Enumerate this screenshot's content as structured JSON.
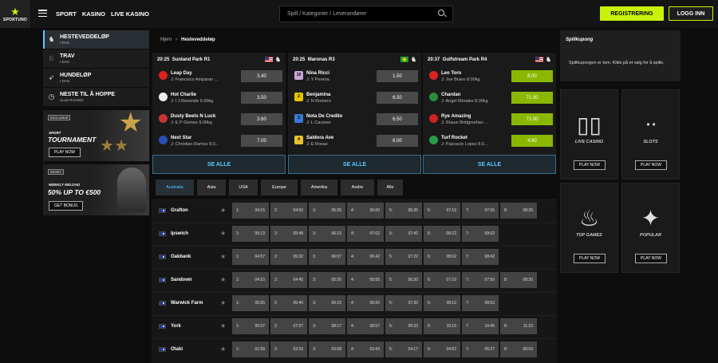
{
  "header": {
    "logo_text": "SPORTUNO",
    "nav": [
      "SPORT",
      "KASINO",
      "LIVE KASINO"
    ],
    "search_placeholder": "Spill / Kategorier / Leverandører",
    "register_label": "REGISTRERING",
    "login_label": "LOGG INN"
  },
  "sidebar": {
    "items": [
      {
        "label": "HESTEVEDDELØP",
        "sub": "I DAG",
        "icon": "horse-icon",
        "active": true
      },
      {
        "label": "TRAV",
        "sub": "I DAG",
        "icon": "trotting-icon"
      },
      {
        "label": "HUNDELØP",
        "sub": "I DAG",
        "icon": "greyhound-icon"
      },
      {
        "label": "NESTE TIL Å HOPPE",
        "sub": "ALLE RACING",
        "icon": "clock-icon"
      }
    ],
    "promo1": {
      "tag": "EXCLUSIVE",
      "line1": "SPORT",
      "title": "TOURNAMENT",
      "button": "PLAY NOW"
    },
    "promo2": {
      "tag": "SPORT",
      "line1": "WEEKLY RELOAD",
      "title": "50% UP TO €500",
      "button": "GET BONUS"
    }
  },
  "breadcrumb": {
    "home": "Hjem",
    "current": "Hesteveddeløp"
  },
  "featured": [
    {
      "time": "20:25",
      "track": "Sunland Park R1",
      "flag": "us",
      "runners": [
        {
          "name": "Leap Day",
          "jockey": "J: Francisco Amparan ...",
          "odds": "3.40",
          "silk": "#d22"
        },
        {
          "name": "Hot Charlie",
          "jockey": "J: I J Resende 9.00kg",
          "odds": "3.50",
          "silk": "#eee"
        },
        {
          "name": "Dusty Beets N Luck",
          "jockey": "J: E P Gomez 9.00kg",
          "odds": "3.60",
          "silk": "#c33"
        },
        {
          "name": "Next Star",
          "jockey": "J: Christian Ramos 9.0...",
          "odds": "7.00",
          "silk": "#2b4fb4"
        }
      ],
      "see_all": "SE ALLE"
    },
    {
      "time": "20:25",
      "track": "Maronas R3",
      "flag": "br",
      "runners": [
        {
          "name": "Nina Ricci",
          "jockey": "J: Y Pereira",
          "odds": "1.50",
          "silk": "#c9a4d8",
          "num": "10"
        },
        {
          "name": "Benjamina",
          "jockey": "J: N Romero",
          "odds": "6.50",
          "silk": "#e2c400",
          "num": "2"
        },
        {
          "name": "Nota De Credito",
          "jockey": "J: L Caceres",
          "odds": "6.50",
          "silk": "#3a7bd5",
          "num": "3"
        },
        {
          "name": "Saldora Ave",
          "jockey": "J: E Rosas",
          "odds": "8.00",
          "silk": "#e8c32a",
          "num": "4"
        }
      ],
      "see_all": "SE ALLE"
    },
    {
      "time": "20:37",
      "track": "Gulfstream Park R4",
      "flag": "us",
      "runners": [
        {
          "name": "Leo Toro",
          "jockey": "J: Joe Bravo 8.00kg",
          "odds": "8.00",
          "silk": "#d22",
          "hl": true
        },
        {
          "name": "Chardan",
          "jockey": "J: Angel Morales 8.00kg",
          "odds": "71.00",
          "silk": "#2a8c3a",
          "hl": true
        },
        {
          "name": "Rye Amazing",
          "jockey": "J: Shaun Bridgmohan ...",
          "odds": "71.00",
          "silk": "#c22",
          "hl": true
        },
        {
          "name": "Turf Rocket",
          "jockey": "J: Pascacio Lopez 8.0...",
          "odds": "4.60",
          "silk": "#2a9c4a",
          "hl": true
        }
      ],
      "see_all": "SE ALLE"
    }
  ],
  "region_tabs": [
    "Australia",
    "Asia",
    "USA",
    "Europe",
    "Amerika",
    "Andre",
    "Alle"
  ],
  "meetings": [
    {
      "venue": "Grafton",
      "races": [
        "04:15",
        "04:50",
        "05:25",
        "06:00",
        "06:35",
        "07:15",
        "07:55",
        "08:35"
      ]
    },
    {
      "venue": "Ipswich",
      "races": [
        "05:13",
        "05:48",
        "06:23",
        "07:02",
        "07:42",
        "08:22",
        "09:02"
      ]
    },
    {
      "venue": "Oakbank",
      "races": [
        "04:57",
        "05:32",
        "06:07",
        "06:42",
        "07:22",
        "08:02",
        "08:42"
      ]
    },
    {
      "venue": "Sandown",
      "races": [
        "04:10",
        "04:45",
        "05:20",
        "05:55",
        "06:30",
        "07:10",
        "07:50",
        "08:30"
      ]
    },
    {
      "venue": "Warwick Farm",
      "races": [
        "05:05",
        "05:40",
        "06:15",
        "06:50",
        "07:30",
        "08:10",
        "08:53"
      ]
    },
    {
      "venue": "York",
      "races": [
        "06:57",
        "07:37",
        "08:17",
        "08:57",
        "09:33",
        "10:10",
        "10:45",
        "11:23"
      ]
    },
    {
      "venue": "Otaki",
      "races": [
        "01:58",
        "02:33",
        "03:08",
        "03:43",
        "04:17",
        "04:52",
        "05:27",
        "06:03"
      ]
    }
  ],
  "betslip": {
    "title": "Spillkupong",
    "empty_text": "Spillkupongen er tom. Klikk på et valg for å spille."
  },
  "tiles": [
    {
      "label": "LIVE CASINO",
      "button": "PLAY NOW",
      "icon": "cards-icon"
    },
    {
      "label": "SLOTS",
      "button": "PLAY NOW",
      "icon": "cherries-icon"
    },
    {
      "label": "TOP GAMES",
      "button": "PLAY NOW",
      "icon": "flame-icon"
    },
    {
      "label": "POPULAR",
      "button": "PLAY NOW",
      "icon": "sparkle-icon"
    }
  ]
}
